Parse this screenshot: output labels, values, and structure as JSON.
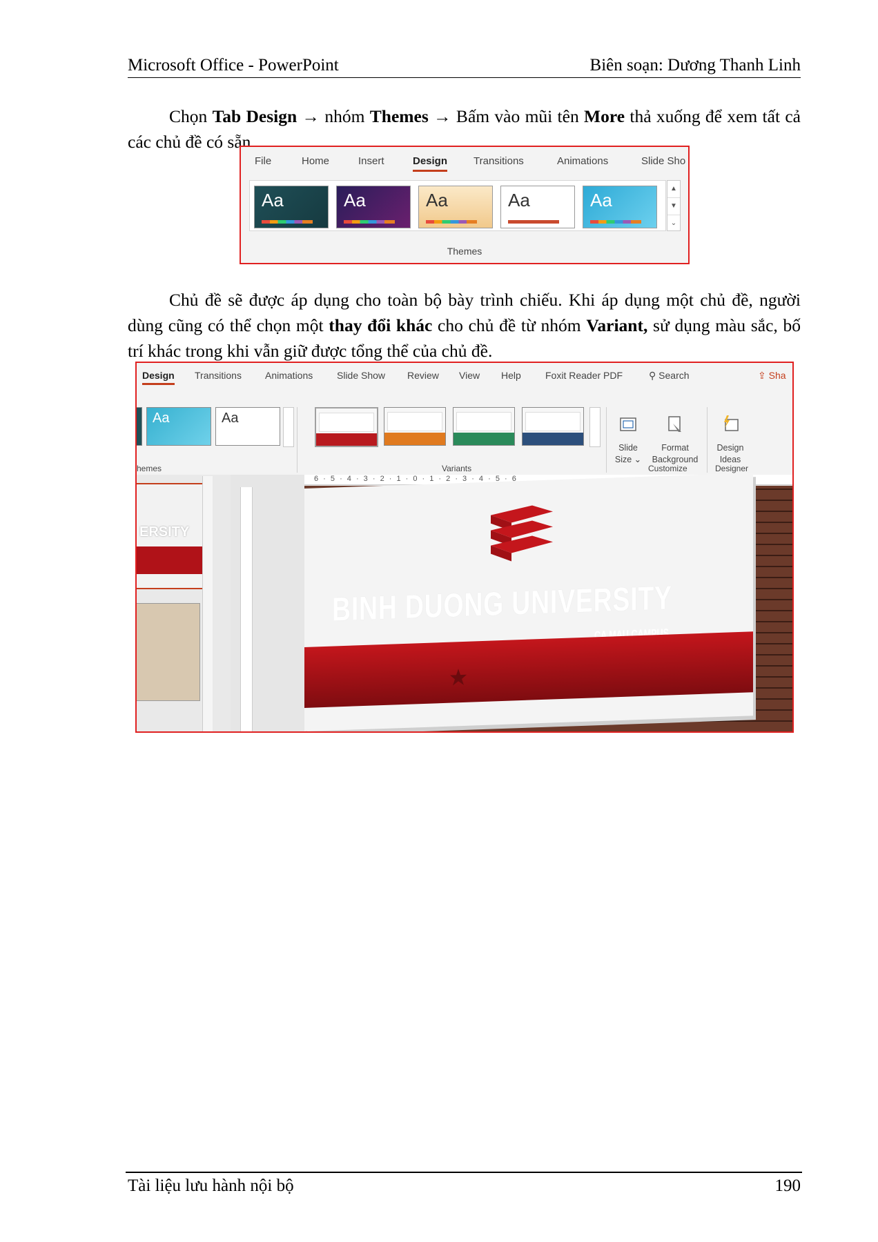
{
  "header": {
    "left": "Microsoft Office - PowerPoint",
    "right": "Biên soạn: Dương Thanh Linh"
  },
  "para1": {
    "t1": "Chọn ",
    "b1": "Tab Design",
    "t2": " → nhóm ",
    "b2": "Themes",
    "t3": " →  Bấm vào mũi tên ",
    "b3": "More",
    "t4": " thả xuống để xem tất cả các chủ đề có sẵn."
  },
  "figure1": {
    "tabs": [
      "File",
      "Home",
      "Insert",
      "Design",
      "Transitions",
      "Animations",
      "Slide Sho"
    ],
    "active_tab": "Design",
    "theme_label": "Aa",
    "group_label": "Themes",
    "scroll_up": "▲",
    "scroll_down": "▼",
    "more": "⌄"
  },
  "para2": {
    "t1": "Chủ đề sẽ được áp dụng cho toàn bộ bày trình chiếu. Khi áp dụng một chủ đề, người dùng cũng có thể chọn một ",
    "b1": "thay đổi khác",
    "t2": " cho chủ đề từ nhóm ",
    "b2": "Variant,",
    "t3": " sử dụng màu sắc, bố trí khác trong khi vẫn giữ được tổng thể của chủ đề."
  },
  "figure2": {
    "tabs": [
      "Design",
      "Transitions",
      "Animations",
      "Slide Show",
      "Review",
      "View",
      "Help",
      "Foxit Reader PDF"
    ],
    "search": "Search",
    "share": "Sha",
    "theme_label": "Aa",
    "groups": {
      "themes": "hemes",
      "variants": "Variants",
      "customize": "Customize",
      "designer": "Designer"
    },
    "buttons": {
      "slide_size_1": "Slide",
      "slide_size_2": "Size ⌄",
      "format_bg_1": "Format",
      "format_bg_2": "Background",
      "design_ideas_1": "Design",
      "design_ideas_2": "Ideas"
    },
    "ruler_text": "6 · 5 · 4 · 3 · 2 · 1 · 0 · 1 · 2 · 3 · 4 · 5 · 6",
    "thumb_text": "ERSITY",
    "slide_title": "BINH DUONG UNIVERSITY",
    "slide_subtitle": "CA MAU CAMPUS",
    "colors": {
      "accent": "#c43e1c",
      "slide_red": "#c4161c",
      "border": "#e02020"
    }
  },
  "footer": {
    "left": "Tài liệu lưu hành nội bộ",
    "page": "190"
  }
}
